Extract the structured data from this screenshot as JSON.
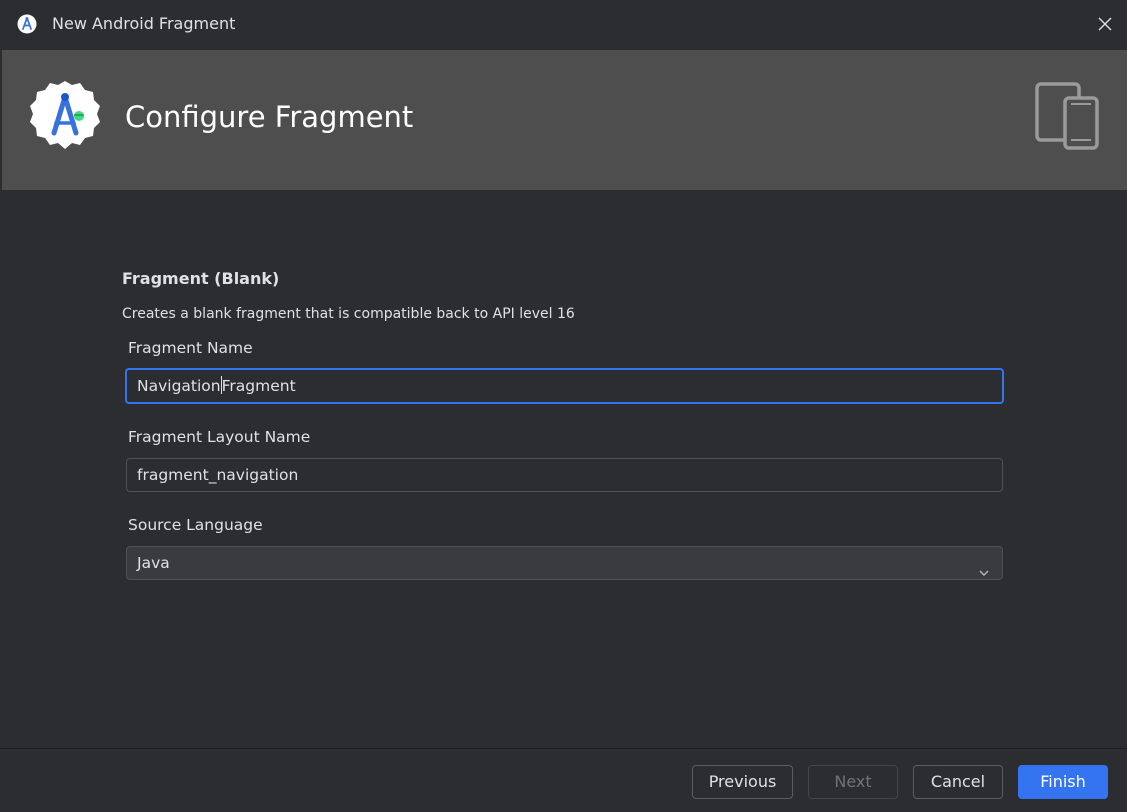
{
  "window": {
    "title": "New Android Fragment"
  },
  "header": {
    "title": "Configure Fragment"
  },
  "section": {
    "title": "Fragment (Blank)",
    "description": "Creates a blank fragment that is compatible back to API level 16"
  },
  "form": {
    "fragment_name_label": "Fragment Name",
    "fragment_name_value_before_caret": "Navigation",
    "fragment_name_value_after_caret": "Fragment",
    "layout_name_label": "Fragment Layout Name",
    "layout_name_value": "fragment_navigation",
    "language_label": "Source Language",
    "language_value": "Java"
  },
  "buttons": {
    "previous": "Previous",
    "next": "Next",
    "cancel": "Cancel",
    "finish": "Finish"
  },
  "colors": {
    "accent": "#3574f0",
    "header_bg": "#4e4e4e",
    "window_bg": "#2b2d30"
  },
  "icons": {
    "app": "android-studio-icon",
    "close": "close-icon",
    "logo": "android-studio-logo-icon",
    "device": "phone-tablet-icon",
    "dropdown": "chevron-down-icon"
  }
}
